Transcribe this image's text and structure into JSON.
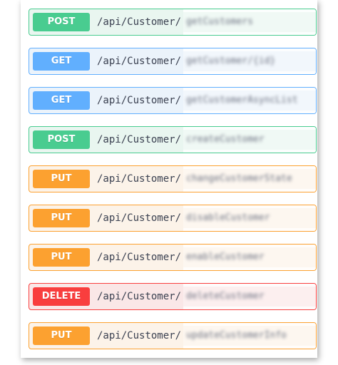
{
  "operations": [
    {
      "method": "POST",
      "path": "/api/Customer/",
      "obscured": "getCustomers"
    },
    {
      "method": "GET",
      "path": "/api/Customer/",
      "obscured": "getCustomer/{id}"
    },
    {
      "method": "GET",
      "path": "/api/Customer/",
      "obscured": "getCustomerAsyncList"
    },
    {
      "method": "POST",
      "path": "/api/Customer/",
      "obscured": "createCustomer"
    },
    {
      "method": "PUT",
      "path": "/api/Customer/",
      "obscured": "changeCustomerState"
    },
    {
      "method": "PUT",
      "path": "/api/Customer/",
      "obscured": "disableCustomer"
    },
    {
      "method": "PUT",
      "path": "/api/Customer/",
      "obscured": "enableCustomer"
    },
    {
      "method": "DELETE",
      "path": "/api/Customer/",
      "obscured": "deleteCustomer"
    },
    {
      "method": "PUT",
      "path": "/api/Customer/",
      "obscured": "updateCustomerInfo"
    }
  ],
  "colors": {
    "post": "#49cc90",
    "get": "#61affe",
    "put": "#fca130",
    "delete": "#f93e3e"
  }
}
